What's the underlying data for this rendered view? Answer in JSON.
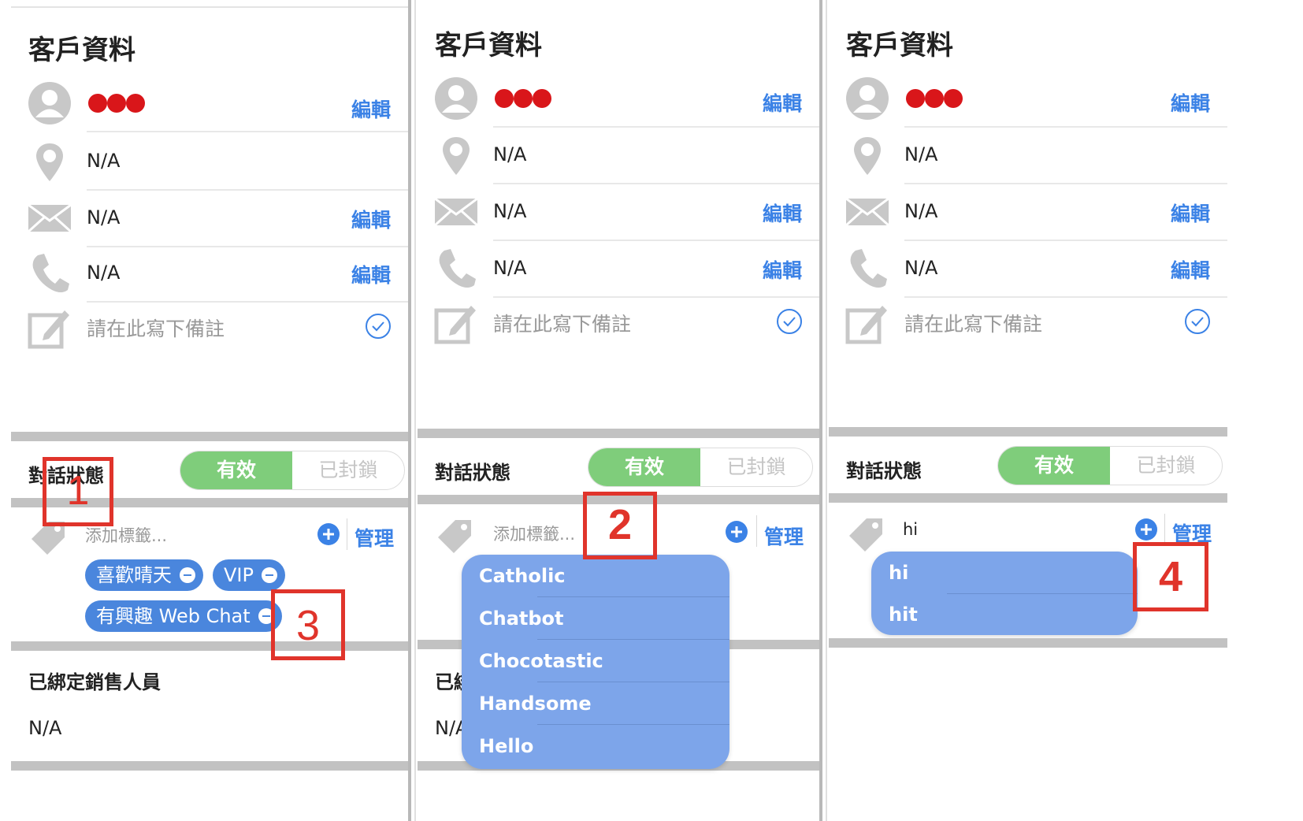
{
  "panels": [
    {
      "title": "客戶資料",
      "name_edit": "編輯",
      "location_value": "N/A",
      "email_value": "N/A",
      "email_edit": "編輯",
      "phone_value": "N/A",
      "phone_edit": "編輯",
      "note_placeholder": "請在此寫下備註",
      "status_label": "對話狀態",
      "status_active": "有效",
      "status_blocked": "已封鎖",
      "tag_placeholder": "添加標籤...",
      "manage": "管理",
      "tags": [
        "喜歡晴天",
        "VIP",
        "有興趣 Web Chat"
      ],
      "sales_title": "已綁定銷售人員",
      "sales_value": "N/A"
    },
    {
      "title": "客戶資料",
      "name_edit": "編輯",
      "location_value": "N/A",
      "email_value": "N/A",
      "email_edit": "編輯",
      "phone_value": "N/A",
      "phone_edit": "編輯",
      "note_placeholder": "請在此寫下備註",
      "status_label": "對話狀態",
      "status_active": "有效",
      "status_blocked": "已封鎖",
      "tag_placeholder": "添加標籤...",
      "manage": "管理",
      "sales_title_partial": "已綁",
      "sales_value_partial": "N/A",
      "dropdown_options": [
        "Catholic",
        "Chatbot",
        "Chocotastic",
        "Handsome",
        "Hello"
      ]
    },
    {
      "title": "客戶資料",
      "name_edit": "編輯",
      "location_value": "N/A",
      "email_value": "N/A",
      "email_edit": "編輯",
      "phone_value": "N/A",
      "phone_edit": "編輯",
      "note_placeholder": "請在此寫下備註",
      "status_label": "對話狀態",
      "status_active": "有效",
      "status_blocked": "已封鎖",
      "tag_input_value": "hi",
      "manage": "管理",
      "dropdown_options": [
        "hi",
        "hit"
      ]
    }
  ],
  "callouts": [
    "1",
    "2",
    "3",
    "4"
  ],
  "colors": {
    "accent_blue": "#3b82e6",
    "active_green": "#7fcd7b",
    "chip_blue": "#4a86dd",
    "dropdown_blue": "#7da5ea",
    "callout_red": "#e0342b",
    "divider_gray": "#c2c2c2"
  },
  "icons": [
    "avatar-icon",
    "location-pin-icon",
    "envelope-icon",
    "phone-icon",
    "note-edit-icon",
    "check-circle-icon",
    "tag-icon",
    "plus-circle-icon",
    "minus-circle-icon",
    "red-dots-icon"
  ]
}
